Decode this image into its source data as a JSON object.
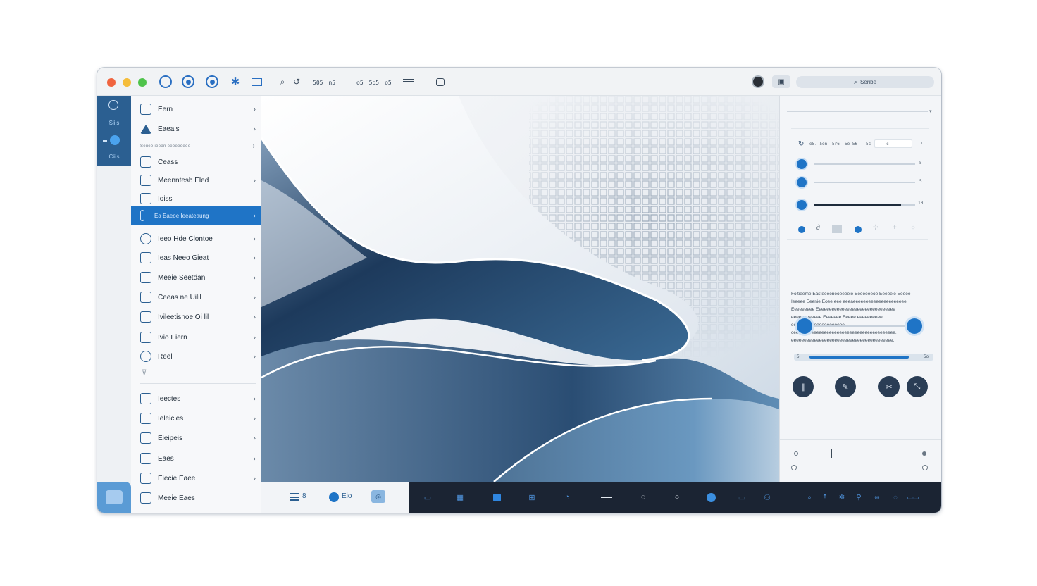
{
  "colors": {
    "accent": "#1f74c6",
    "dark_bar": "#1b2433",
    "rail": "#2b5f91",
    "traffic_red": "#f0643f",
    "traffic_yellow": "#f5bd3b",
    "traffic_green": "#4fc34b"
  },
  "titlebar": {
    "text_groups": [
      "505",
      "n5",
      "o5",
      "5o5",
      "o5"
    ],
    "search_label": "Seribe"
  },
  "rail": {
    "label_1": "Siils",
    "label_2": "Ciils"
  },
  "menu": {
    "items": [
      {
        "label": "Eern",
        "icon": "square-icon",
        "has_sub": true
      },
      {
        "label": "Eaeals",
        "icon": "triangle-icon",
        "has_sub": true
      },
      {
        "label": "Ceass",
        "icon": "grid-icon",
        "has_sub": false
      },
      {
        "label": "Meenntesb Eled",
        "icon": "doc-icon",
        "has_sub": true
      },
      {
        "label": "Ioiss",
        "icon": "image-icon",
        "has_sub": false
      },
      {
        "label": "Ea Eaeoe Ieeateaung",
        "icon": "columns-icon",
        "has_sub": true,
        "selected": true
      },
      {
        "label": "Ieeo Hde Clontoe",
        "icon": "globe-icon",
        "has_sub": true
      },
      {
        "label": "Ieas Neeo Gieat",
        "icon": "square-icon",
        "has_sub": true
      },
      {
        "label": "Meeie Seetdan",
        "icon": "image-icon",
        "has_sub": true
      },
      {
        "label": "Ceeas ne Uilil",
        "icon": "tag-icon",
        "has_sub": true
      },
      {
        "label": "Ivileetisnoe Oi lil",
        "icon": "window-icon",
        "has_sub": true
      },
      {
        "label": "Ivio Eiern",
        "icon": "shield-icon",
        "has_sub": true
      },
      {
        "label": "Reel",
        "icon": "link-icon",
        "has_sub": true
      },
      {
        "label": "Ieectes",
        "icon": "book-icon",
        "has_sub": true
      },
      {
        "label": "Ieleicies",
        "icon": "list-icon",
        "has_sub": true
      },
      {
        "label": "Eieipeis",
        "icon": "chart-icon",
        "has_sub": true
      },
      {
        "label": "Eaes",
        "icon": "page-icon",
        "has_sub": true
      },
      {
        "label": "Eiecie Eaee",
        "icon": "photo-icon",
        "has_sub": true
      },
      {
        "label": "Meeie Eaes",
        "icon": "file-icon",
        "has_sub": false
      }
    ],
    "section_label": "Seiiee ieean eeeeeeeee"
  },
  "bottom_light": {
    "label_1": "8",
    "label_2": "Eio"
  },
  "panel": {
    "row_labels": [
      "e5. 5en",
      "5r6",
      "5e 56",
      "5c",
      "c"
    ],
    "slider_values": [
      0.0,
      0.0,
      0.86
    ],
    "slider_end_labels": [
      "5",
      "5",
      "10"
    ],
    "paragraph": "Foitieeme Easteeeeneoeeeeie Eeeeeeeoe Eeeeeie Eeeee Ieeeee Eeenie Eoee eee eeeaeeeeeeeeeeeeeeeeeeeee Eeeeeeeee Eeeeeeeeeeeeeeeeeeeeeeeeeeeeeee eeeeeeeeeeee Eeeeeee Eeeee eeeeeeeeee eeeeeeeeeeeeeeeeeeeee ceeeeeeeeeeeeeeeeeeeeeeeeeeeeeeeeeeeeeeee. eeeeeeeeeeeeeeeeeeeeeeeeeeeeeeeeeeeeeeee.",
    "range_slider": {
      "low": 0.0,
      "high": 1.0
    },
    "progress": 0.88,
    "progress_labels": [
      "5",
      "5o"
    ],
    "bottom_slider": 0.3
  }
}
